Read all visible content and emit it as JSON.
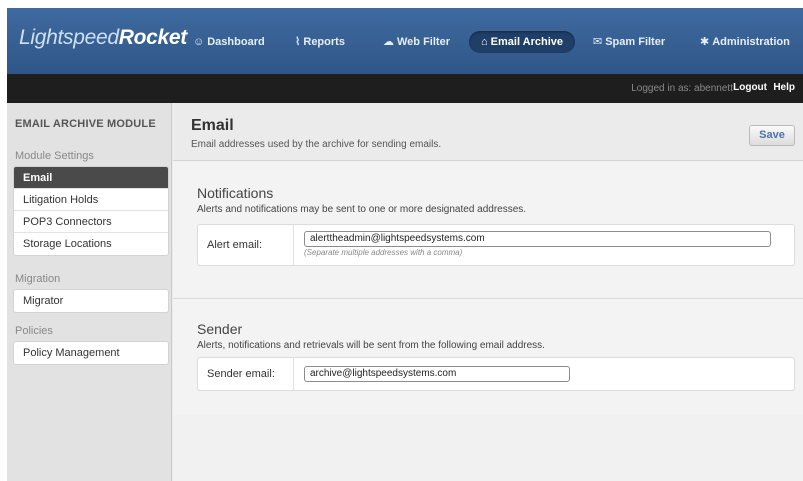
{
  "logo": {
    "light": "Lightspeed",
    "bold": "Rocket"
  },
  "nav": {
    "items": [
      {
        "label": "Dashboard",
        "icon": "dashboard-icon",
        "glyph": "☺"
      },
      {
        "label": "Reports",
        "icon": "reports-icon",
        "glyph": "⌇"
      },
      {
        "label": "Web Filter",
        "icon": "web-filter-icon",
        "glyph": "☁"
      },
      {
        "label": "Email Archive",
        "icon": "email-archive-icon",
        "glyph": "⌂"
      },
      {
        "label": "Spam Filter",
        "icon": "spam-filter-icon",
        "glyph": "✉"
      },
      {
        "label": "Administration",
        "icon": "administration-icon",
        "glyph": "✱"
      }
    ],
    "active": "Email Archive"
  },
  "loginbar": {
    "logged_in_text": "Logged in as: abennett",
    "logout": "Logout",
    "help": "Help"
  },
  "sidebar": {
    "module_title": "EMAIL ARCHIVE MODULE",
    "sections": [
      {
        "heading": "Module Settings",
        "items": [
          "Email",
          "Litigation Holds",
          "POP3 Connectors",
          "Storage Locations"
        ]
      },
      {
        "heading": "Migration",
        "items": [
          "Migrator"
        ]
      },
      {
        "heading": "Policies",
        "items": [
          "Policy Management"
        ]
      }
    ],
    "active_item": "Email"
  },
  "page": {
    "title": "Email",
    "subtitle": "Email addresses used by the archive for sending emails.",
    "save_label": "Save"
  },
  "notifications": {
    "title": "Notifications",
    "description": "Alerts and notifications may be sent to one or more designated addresses.",
    "field_label": "Alert email:",
    "value": "alerttheadmin@lightspeedsystems.com",
    "hint": "(Separate multiple addresses with a comma)"
  },
  "sender": {
    "title": "Sender",
    "description": "Alerts, notifications and retrievals will be sent from the following email address.",
    "field_label": "Sender email:",
    "value": "archive@lightspeedsystems.com"
  },
  "colors": {
    "nav_bg": "#35609a",
    "nav_active": "#1f3f69",
    "login_bar": "#1e1e1e",
    "save_text": "#4a73a6",
    "sidebar_active": "#4a4a4a"
  }
}
